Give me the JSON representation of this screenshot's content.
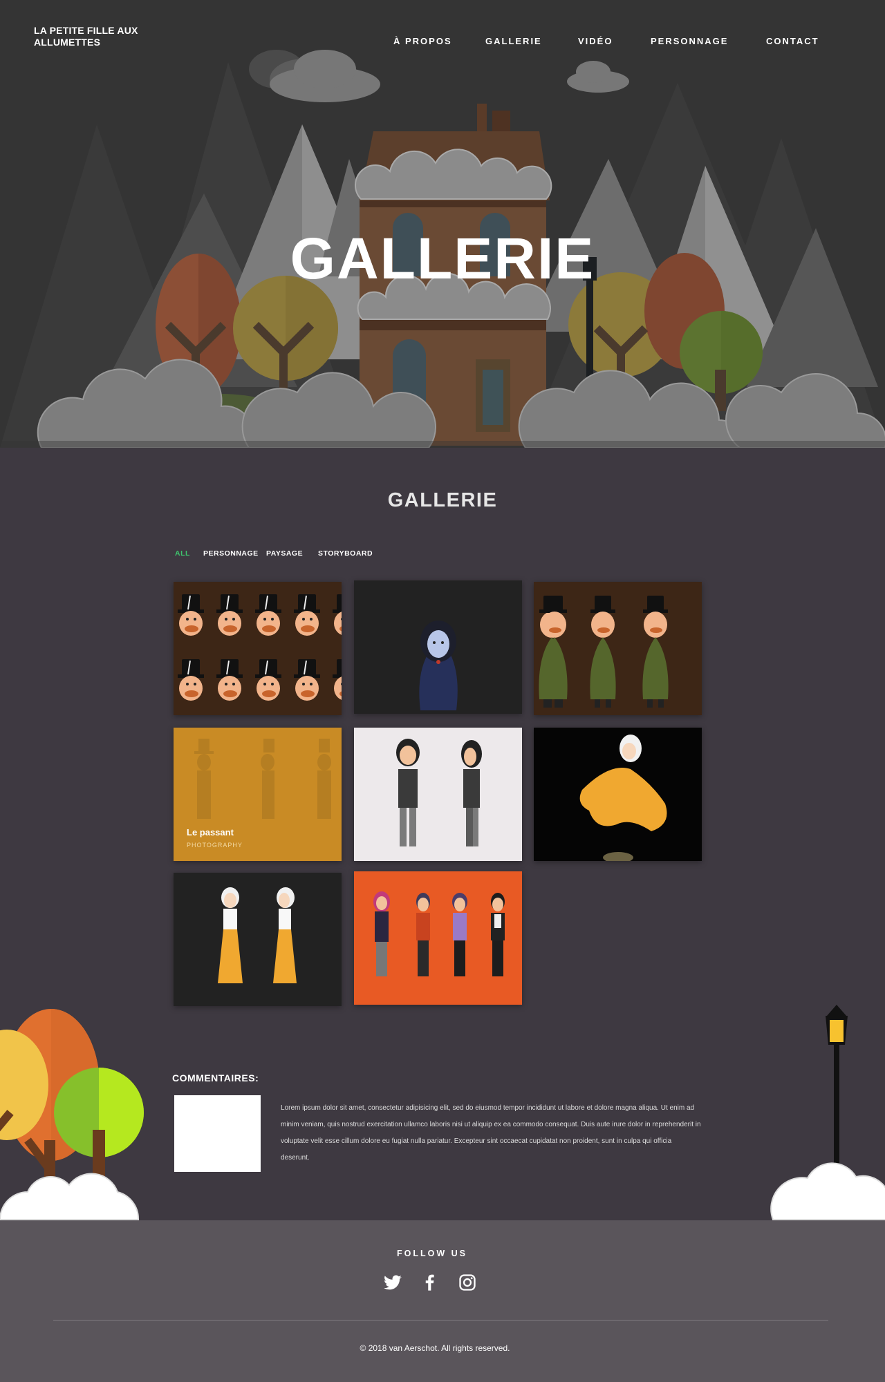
{
  "brand": {
    "name": "LA PETITE FILLE AUX ALLUMETTES"
  },
  "nav": {
    "items": [
      {
        "label": "À PROPOS"
      },
      {
        "label": "GALLERIE"
      },
      {
        "label": "VIDÉO"
      },
      {
        "label": "PERSONNAGE"
      },
      {
        "label": "CONTACT"
      }
    ]
  },
  "hero": {
    "title": "GALLERIE"
  },
  "gallery": {
    "title": "GALLERIE",
    "filters": [
      {
        "label": "ALL",
        "active": true
      },
      {
        "label": "PERSONNAGE",
        "active": false
      },
      {
        "label": "PAYSAGE",
        "active": false
      },
      {
        "label": "STORYBOARD",
        "active": false
      }
    ],
    "hover_caption": {
      "title": "Le passant",
      "subtitle": "PHOTOGRAPHY"
    }
  },
  "comments": {
    "title": "COMMENTAIRES:",
    "text": "Lorem ipsum dolor sit amet, consectetur adipisicing elit, sed do eiusmod tempor incididunt ut labore et dolore magna aliqua. Ut enim ad minim veniam, quis nostrud exercitation ullamco laboris nisi ut aliquip ex ea commodo consequat. Duis aute irure dolor in reprehenderit in voluptate velit esse cillum dolore eu fugiat nulla pariatur. Excepteur sint occaecat cupidatat non proident, sunt in culpa qui officia deserunt."
  },
  "footer": {
    "follow": "FOLLOW US",
    "social": [
      {
        "icon": "twitter-icon"
      },
      {
        "icon": "facebook-icon"
      },
      {
        "icon": "instagram-icon"
      }
    ],
    "copyright": "© 2018 van Aerschot. All rights reserved."
  },
  "colors": {
    "accent_active": "#3ec46d",
    "page_background": "#3e3941",
    "footer_background": "#5a555b"
  }
}
